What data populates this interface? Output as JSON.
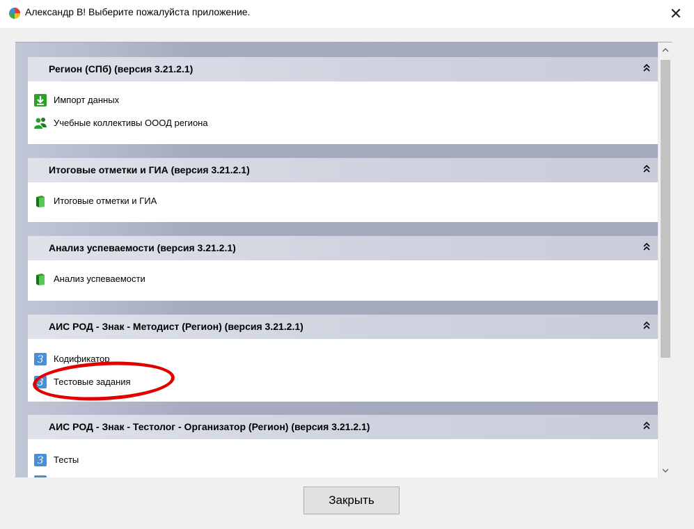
{
  "window": {
    "title": "Александр В! Выберите пожалуйста приложение.",
    "app_icon": "multicolor-globe-icon",
    "close_glyph": "✕"
  },
  "sections": [
    {
      "title": "Регион (СПб) (версия 3.21.2.1)",
      "items": [
        {
          "label": "Импорт данных",
          "icon": "green-download-icon"
        },
        {
          "label": "Учебные коллективы ОООД региона",
          "icon": "green-users-icon"
        }
      ]
    },
    {
      "title": "Итоговые отметки и ГИА (версия 3.21.2.1)",
      "items": [
        {
          "label": "Итоговые отметки и ГИА",
          "icon": "green-book-icon"
        }
      ]
    },
    {
      "title": "Анализ успеваемости (версия 3.21.2.1)",
      "items": [
        {
          "label": "Анализ успеваемости",
          "icon": "green-book-icon"
        }
      ]
    },
    {
      "title": "АИС РОД - Знак - Методист (Регион) (версия 3.21.2.1)",
      "items": [
        {
          "label": "Кодификатор",
          "icon": "blue-z-icon"
        },
        {
          "label": "Тестовые задания",
          "icon": "blue-z-icon"
        }
      ]
    },
    {
      "title": "АИС РОД - Знак - Тестолог - Организатор (Регион) (версия 3.21.2.1)",
      "items": [
        {
          "label": "Тесты",
          "icon": "blue-z-icon"
        }
      ]
    }
  ],
  "footer": {
    "close_label": "Закрыть"
  },
  "colors": {
    "list_background": "#a6abc0",
    "header_background": "#d5d8e2",
    "annotation": "#e00000",
    "icon_green": "#2e9e2e",
    "icon_blue": "#4a8fd4"
  }
}
